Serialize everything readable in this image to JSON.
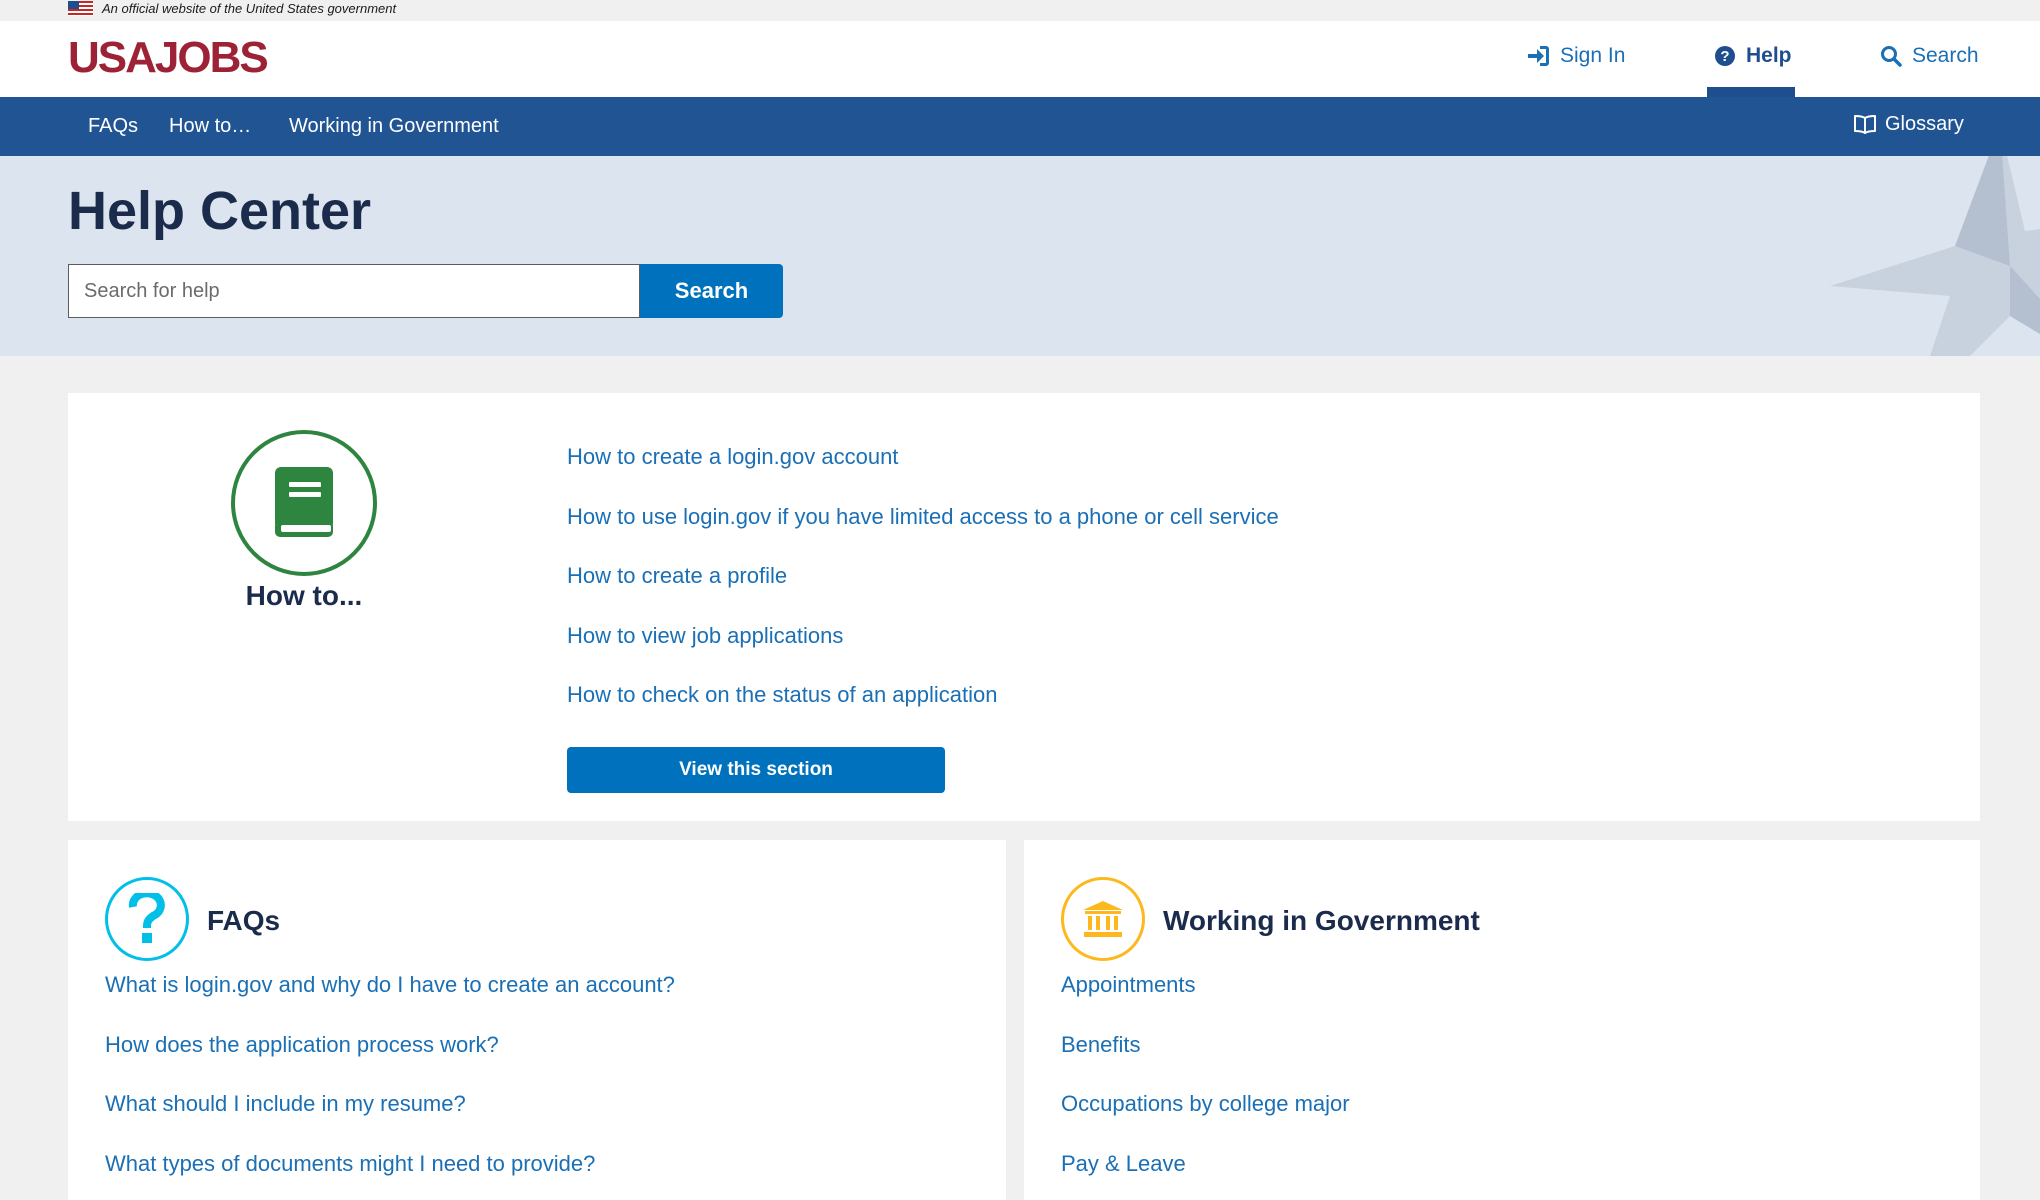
{
  "gov_banner": {
    "text": "An official website of the United States government"
  },
  "header": {
    "logo": "USAJOBS",
    "links": [
      {
        "label": "Sign In",
        "icon": "sign-in-icon"
      },
      {
        "label": "Help",
        "icon": "question-circle-icon",
        "active": true
      },
      {
        "label": "Search",
        "icon": "search-icon"
      }
    ]
  },
  "nav": {
    "items": [
      "FAQs",
      "How to…",
      "Working in Government"
    ],
    "glossary": "Glossary"
  },
  "hero": {
    "title": "Help Center",
    "search_placeholder": "Search for help",
    "search_button": "Search"
  },
  "howto": {
    "label": "How to...",
    "links": [
      "How to create a login.gov account",
      "How to use login.gov if you have limited access to a phone or cell service",
      "How to create a profile",
      "How to view job applications",
      "How to check on the status of an application"
    ],
    "button": "View this section"
  },
  "faqs": {
    "title": "FAQs",
    "links": [
      "What is login.gov and why do I have to create an account?",
      "How does the application process work?",
      "What should I include in my resume?",
      "What types of documents might I need to provide?"
    ]
  },
  "working_in_government": {
    "title": "Working in Government",
    "links": [
      "Appointments",
      "Benefits",
      "Occupations by college major",
      "Pay & Leave"
    ]
  },
  "colors": {
    "brand_red": "#9d2235",
    "nav_blue": "#205493",
    "link_blue": "#1a6fb5",
    "button_blue": "#0071bc",
    "green": "#2e8540",
    "cyan": "#02bfe7",
    "gold": "#fdb81e"
  }
}
